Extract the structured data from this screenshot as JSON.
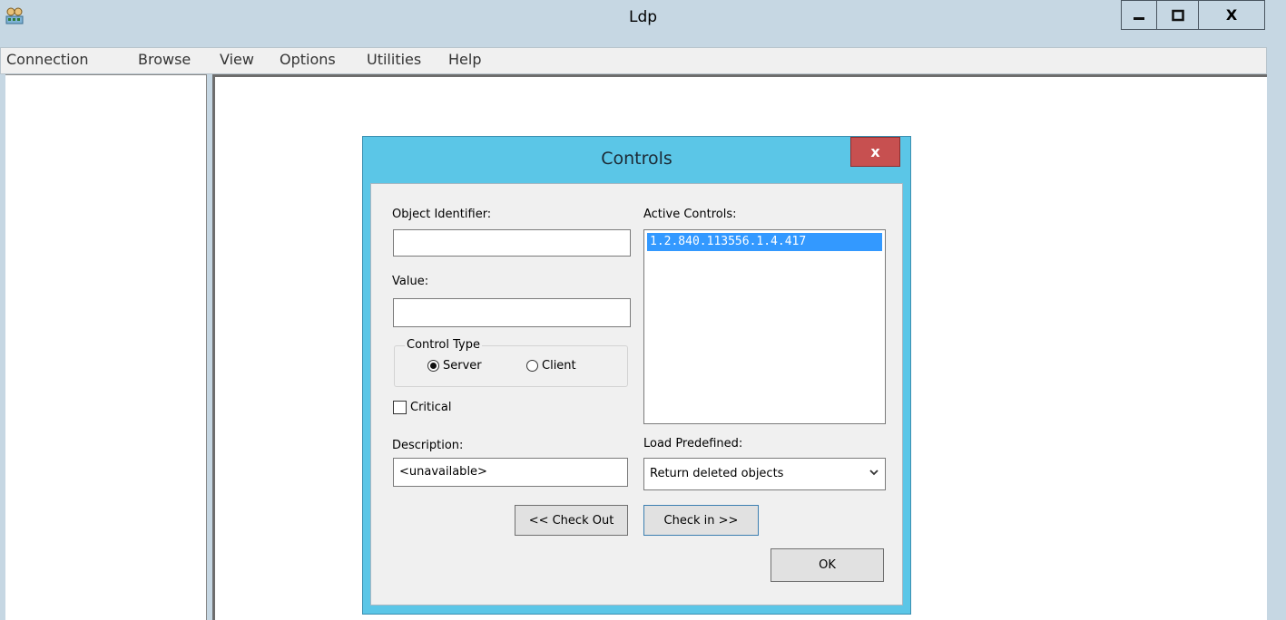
{
  "window": {
    "title": "Ldp",
    "app_icon": "ldp-app-icon",
    "minimize_icon": "minimize-icon",
    "maximize_icon": "maximize-icon",
    "close_label": "X"
  },
  "menu": {
    "items": [
      {
        "label": "Connection"
      },
      {
        "label": "Browse"
      },
      {
        "label": "View"
      },
      {
        "label": "Options"
      },
      {
        "label": "Utilities"
      },
      {
        "label": "Help"
      }
    ]
  },
  "dialog": {
    "title": "Controls",
    "close_label": "x",
    "object_identifier": {
      "label": "Object Identifier:",
      "value": ""
    },
    "value_field": {
      "label": "Value:",
      "value": ""
    },
    "control_type": {
      "caption": "Control Type",
      "options": [
        {
          "label": "Server",
          "selected": true
        },
        {
          "label": "Client",
          "selected": false
        }
      ]
    },
    "critical": {
      "label": "Critical",
      "checked": false
    },
    "description": {
      "label": "Description:",
      "value": "<unavailable>"
    },
    "active_controls": {
      "label": "Active Controls:",
      "items": [
        "1.2.840.113556.1.4.417"
      ],
      "selected_index": 0
    },
    "load_predefined": {
      "label": "Load Predefined:",
      "selected": "Return deleted objects",
      "arrow_icon": "chevron-down-icon"
    },
    "check_out_label": "<< Check Out",
    "check_in_label": "Check in >>",
    "ok_label": "OK"
  },
  "colors": {
    "window_frame": "#c6d7e3",
    "dialog_frame": "#5bc6e7",
    "dialog_close": "#c75050",
    "selection": "#3399ff",
    "dialog_body": "#f0f0f0"
  }
}
